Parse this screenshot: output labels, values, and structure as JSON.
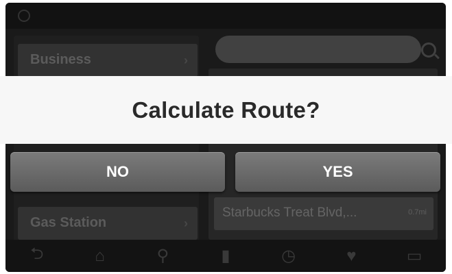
{
  "dialog": {
    "title": "Calculate Route?",
    "no_label": "NO",
    "yes_label": "YES"
  },
  "background": {
    "categories": [
      {
        "label": "Business"
      },
      {
        "label": "Gas Station"
      }
    ],
    "result_item": {
      "label": "Starbucks Treat Blvd,...",
      "distance": "0.7mi"
    }
  },
  "colors": {
    "modal_band": "#f7f7f7",
    "button": "#6b6b6b",
    "overlay": "#1a1a1a"
  }
}
